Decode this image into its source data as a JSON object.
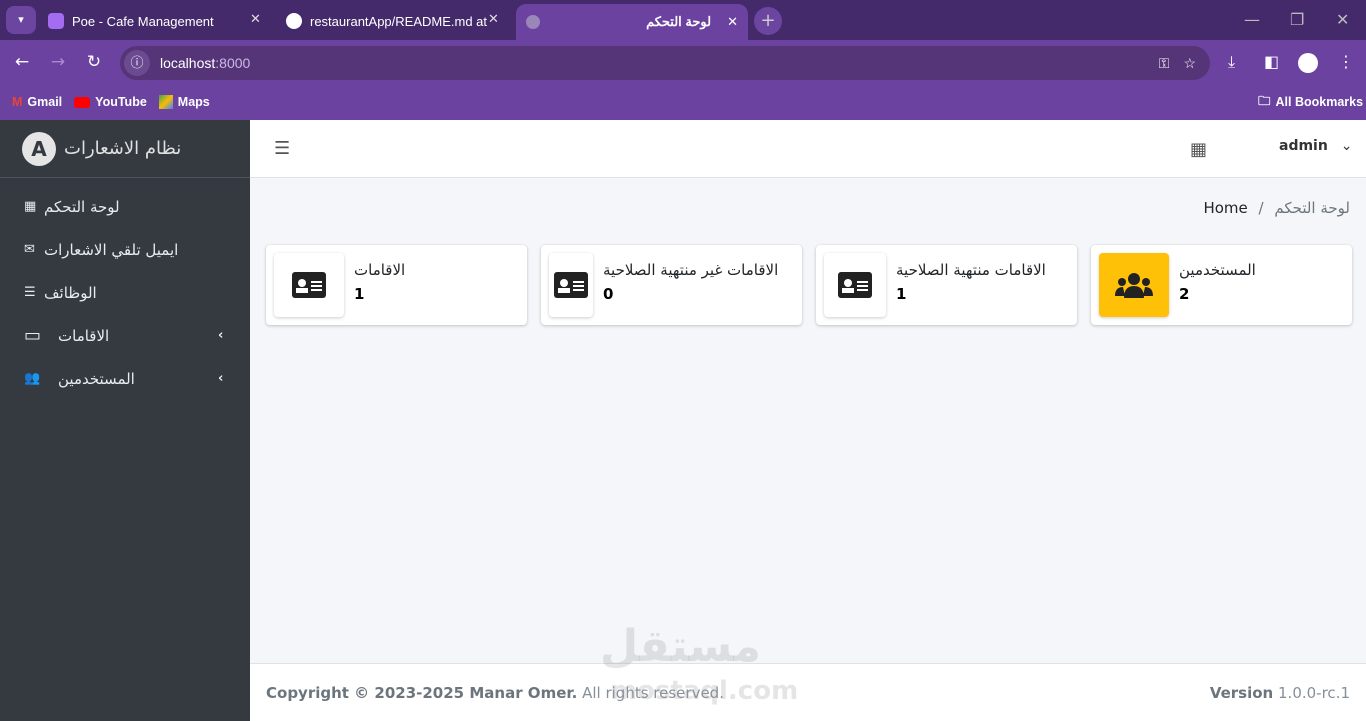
{
  "browser": {
    "tabs": [
      {
        "title": "Poe - Cafe Management",
        "icon": "poe-icon"
      },
      {
        "title": "restaurantApp/README.md at",
        "icon": "github-icon"
      },
      {
        "title": "لوحة التحكم",
        "icon": "globe-icon"
      }
    ],
    "url_host": "localhost",
    "url_port": ":8000",
    "bookmarks": [
      "Gmail",
      "YouTube",
      "Maps"
    ],
    "all_bookmarks": "All Bookmarks"
  },
  "sidebar": {
    "brand": "نظام الاشعارات",
    "logo_letter": "A",
    "items": [
      {
        "label": "لوحة التحكم",
        "icon": "▦"
      },
      {
        "label": "ايميل تلقي الاشعارات",
        "icon": "✉"
      },
      {
        "label": "الوظائف",
        "icon": "☰"
      },
      {
        "label": "الاقامات",
        "icon": "▭"
      },
      {
        "label": "المستخدمين",
        "icon": "👥"
      }
    ]
  },
  "topnav": {
    "user": "admin"
  },
  "breadcrumb": {
    "home": "Home",
    "sep": "/",
    "current": "لوحة التحكم"
  },
  "cards": [
    {
      "label": "الاقامات",
      "value": "1"
    },
    {
      "label": "الاقامات غير منتهية الصلاحية",
      "value": "0"
    },
    {
      "label": "الاقامات منتهية الصلاحية",
      "value": "1"
    },
    {
      "label": "المستخدمين",
      "value": "2"
    }
  ],
  "colors": {
    "accent": "#ffc107",
    "sidebar": "#343a40",
    "browser": "#6c42a1"
  },
  "footer": {
    "copyright": "Copyright © 2023-2025 Manar Omer.",
    "rights": "All rights reserved.",
    "version_label": "Version",
    "version": "1.0.0-rc.1"
  },
  "watermark": {
    "ar": "مستقل",
    "en": "mostaql.com"
  }
}
